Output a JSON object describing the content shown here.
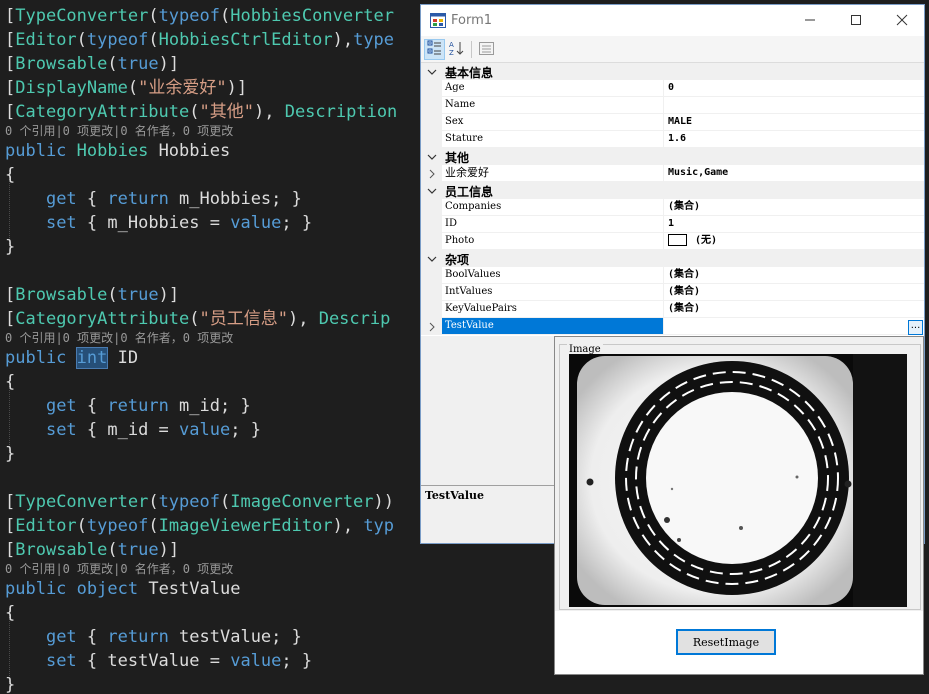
{
  "code": {
    "l1": {
      "b1": "[",
      "t1": "TypeConverter",
      "p1": "(",
      "k1": "typeof",
      "p2": "(",
      "t2": "HobbiesConverter"
    },
    "l2": {
      "b1": "[",
      "t1": "Editor",
      "p1": "(",
      "k1": "typeof",
      "p2": "(",
      "t2": "HobbiesCtrlEditor",
      "p3": "),",
      "k2": "type"
    },
    "l3": {
      "b1": "[",
      "t1": "Browsable",
      "p1": "(",
      "k1": "true",
      "p2": ")]"
    },
    "l4": {
      "b1": "[",
      "t1": "DisplayName",
      "p1": "(",
      "s1": "\"业余爱好\"",
      "p2": ")]"
    },
    "l5": {
      "b1": "[",
      "t1": "CategoryAttribute",
      "p1": "(",
      "s1": "\"其他\"",
      "p2": "), ",
      "t2": "Description"
    },
    "lens1": "0 个引用|0 项更改|0 名作者，0 项更改",
    "l6": {
      "k1": "public",
      "sp": " ",
      "t1": "Hobbies",
      "rest": " Hobbies"
    },
    "l7": "{",
    "l8": {
      "ind": "    ",
      "k1": "get",
      "a": " { ",
      "k2": "return",
      "b": " m_Hobbies; }"
    },
    "l9": {
      "ind": "    ",
      "k1": "set",
      "a": " { m_Hobbies = ",
      "k2": "value",
      "b": "; }"
    },
    "l10": "}",
    "l11": {
      "b1": "[",
      "t1": "Browsable",
      "p1": "(",
      "k1": "true",
      "p2": ")]"
    },
    "l12": {
      "b1": "[",
      "t1": "CategoryAttribute",
      "p1": "(",
      "s1": "\"员工信息\"",
      "p2": "), ",
      "t2": "Descrip"
    },
    "lens2": "0 个引用|0 项更改|0 名作者，0 项更改",
    "l13": {
      "k1": "public",
      "sp": " ",
      "k2": "int",
      "rest": " ID"
    },
    "l14": "{",
    "l15": {
      "ind": "    ",
      "k1": "get",
      "a": " { ",
      "k2": "return",
      "b": " m_id; }"
    },
    "l16": {
      "ind": "    ",
      "k1": "set",
      "a": " { m_id = ",
      "k2": "value",
      "b": "; }"
    },
    "l17": "}",
    "l18": {
      "b1": "[",
      "t1": "TypeConverter",
      "p1": "(",
      "k1": "typeof",
      "p2": "(",
      "t2": "ImageConverter",
      "p3": "))"
    },
    "l19": {
      "b1": "[",
      "t1": "Editor",
      "p1": "(",
      "k1": "typeof",
      "p2": "(",
      "t2": "ImageViewerEditor",
      "p3": "), ",
      "k2": "typ"
    },
    "l20": {
      "b1": "[",
      "t1": "Browsable",
      "p1": "(",
      "k1": "true",
      "p2": ")]"
    },
    "lens3": "0 个引用|0 项更改|0 名作者，0 项更改",
    "l21": {
      "k1": "public",
      "sp": " ",
      "k2": "object",
      "rest": " TestValue"
    },
    "l22": "{",
    "l23": {
      "ind": "    ",
      "k1": "get",
      "a": " { ",
      "k2": "return",
      "b": " testValue; }"
    },
    "l24": {
      "ind": "    ",
      "k1": "set",
      "a": " { testValue = ",
      "k2": "value",
      "b": "; }"
    },
    "l25": "}"
  },
  "form": {
    "title": "Form1",
    "min_glyph": "—",
    "max_glyph": "☐",
    "close_glyph": "✕"
  },
  "grid": {
    "categories": [
      {
        "label": "基本信息"
      },
      {
        "label": "其他"
      },
      {
        "label": "员工信息"
      },
      {
        "label": "杂项"
      }
    ],
    "rows": [
      {
        "name": "Age",
        "value": "0"
      },
      {
        "name": "Name",
        "value": ""
      },
      {
        "name": "Sex",
        "value": "MALE"
      },
      {
        "name": "Stature",
        "value": "1.6"
      },
      {
        "name": "业余爱好",
        "value": "Music,Game"
      },
      {
        "name": "Companies",
        "value": "(集合)"
      },
      {
        "name": "ID",
        "value": "1"
      },
      {
        "name": "Photo",
        "value": "(无)"
      },
      {
        "name": "BoolValues",
        "value": "(集合)"
      },
      {
        "name": "IntValues",
        "value": "(集合)"
      },
      {
        "name": "KeyValuePairs",
        "value": "(集合)"
      },
      {
        "name": "TestValue",
        "value": ""
      }
    ],
    "ellipsis": "..."
  },
  "help": {
    "title": "TestValue"
  },
  "popup": {
    "group_label": "Image",
    "reset_label": "ResetImage"
  },
  "colors": {
    "keyword": "#569cd6",
    "type": "#4ec9b0",
    "string": "#d69d85",
    "selection": "#0078d7",
    "editor_bg": "#1e1e1e"
  }
}
